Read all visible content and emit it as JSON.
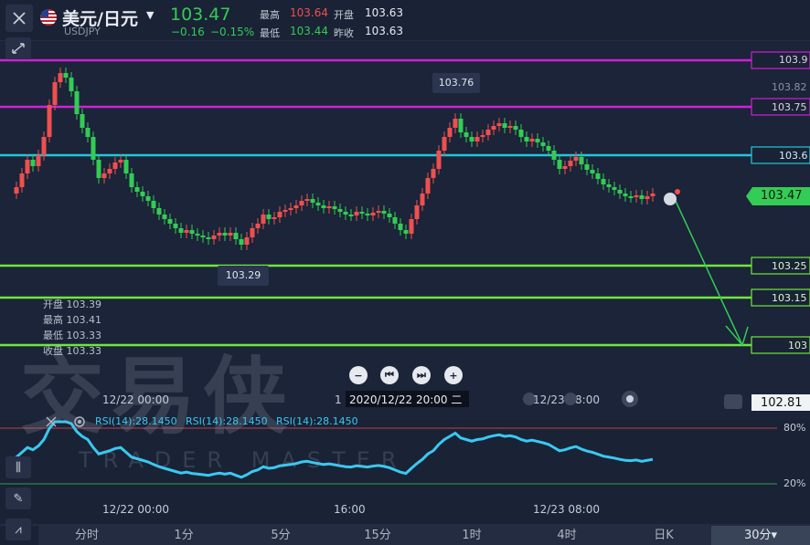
{
  "header": {
    "symbol_name": "美元/日元",
    "symbol_code": "USDJPY",
    "last_price": "103.47",
    "change": "−0.16",
    "change_pct": "−0.15%",
    "high_label": "最高",
    "high_value": "103.64",
    "open_label": "开盘",
    "open_value": "103.63",
    "low_label": "最低",
    "low_value": "103.44",
    "prev_close_label": "昨收",
    "prev_close_value": "103.63"
  },
  "price_axis": {
    "labels": [
      "103.9",
      "103.82",
      "103.75",
      "103.6",
      "103.47",
      "103.25",
      "103.15",
      "103",
      "102.81"
    ]
  },
  "chart_labels": {
    "high_marker": "103.76",
    "low_marker": "103.29"
  },
  "ohlc": {
    "open": "开盘 103.39",
    "high": "最高 103.41",
    "low": "最低 103.33",
    "close": "收盘 103.33"
  },
  "time_axis": {
    "main": [
      "12/22 00:00",
      "12/23 08:00"
    ],
    "tooltip": "2020/12/22 20:00 二",
    "rsi": [
      "12/22 00:00",
      "16:00",
      "12/23 08:00"
    ]
  },
  "rsi": {
    "labels": [
      "RSI(14):28.1450",
      "RSI(14):28.1450",
      "RSI(14):28.1450"
    ],
    "level_high": "80%",
    "level_low": "20%"
  },
  "watermark": {
    "main": "交易侠",
    "sub": "TRADER MASTER"
  },
  "tabs": [
    "分时",
    "1分",
    "5分",
    "15分",
    "1时",
    "4时",
    "日K",
    "30分▾"
  ],
  "colors": {
    "up": "#ef4f4f",
    "down": "#33cc55",
    "magenta": "#d020d8",
    "cyan": "#22c7dc",
    "lime": "#6ee83a",
    "rsi": "#39c9f0"
  }
}
